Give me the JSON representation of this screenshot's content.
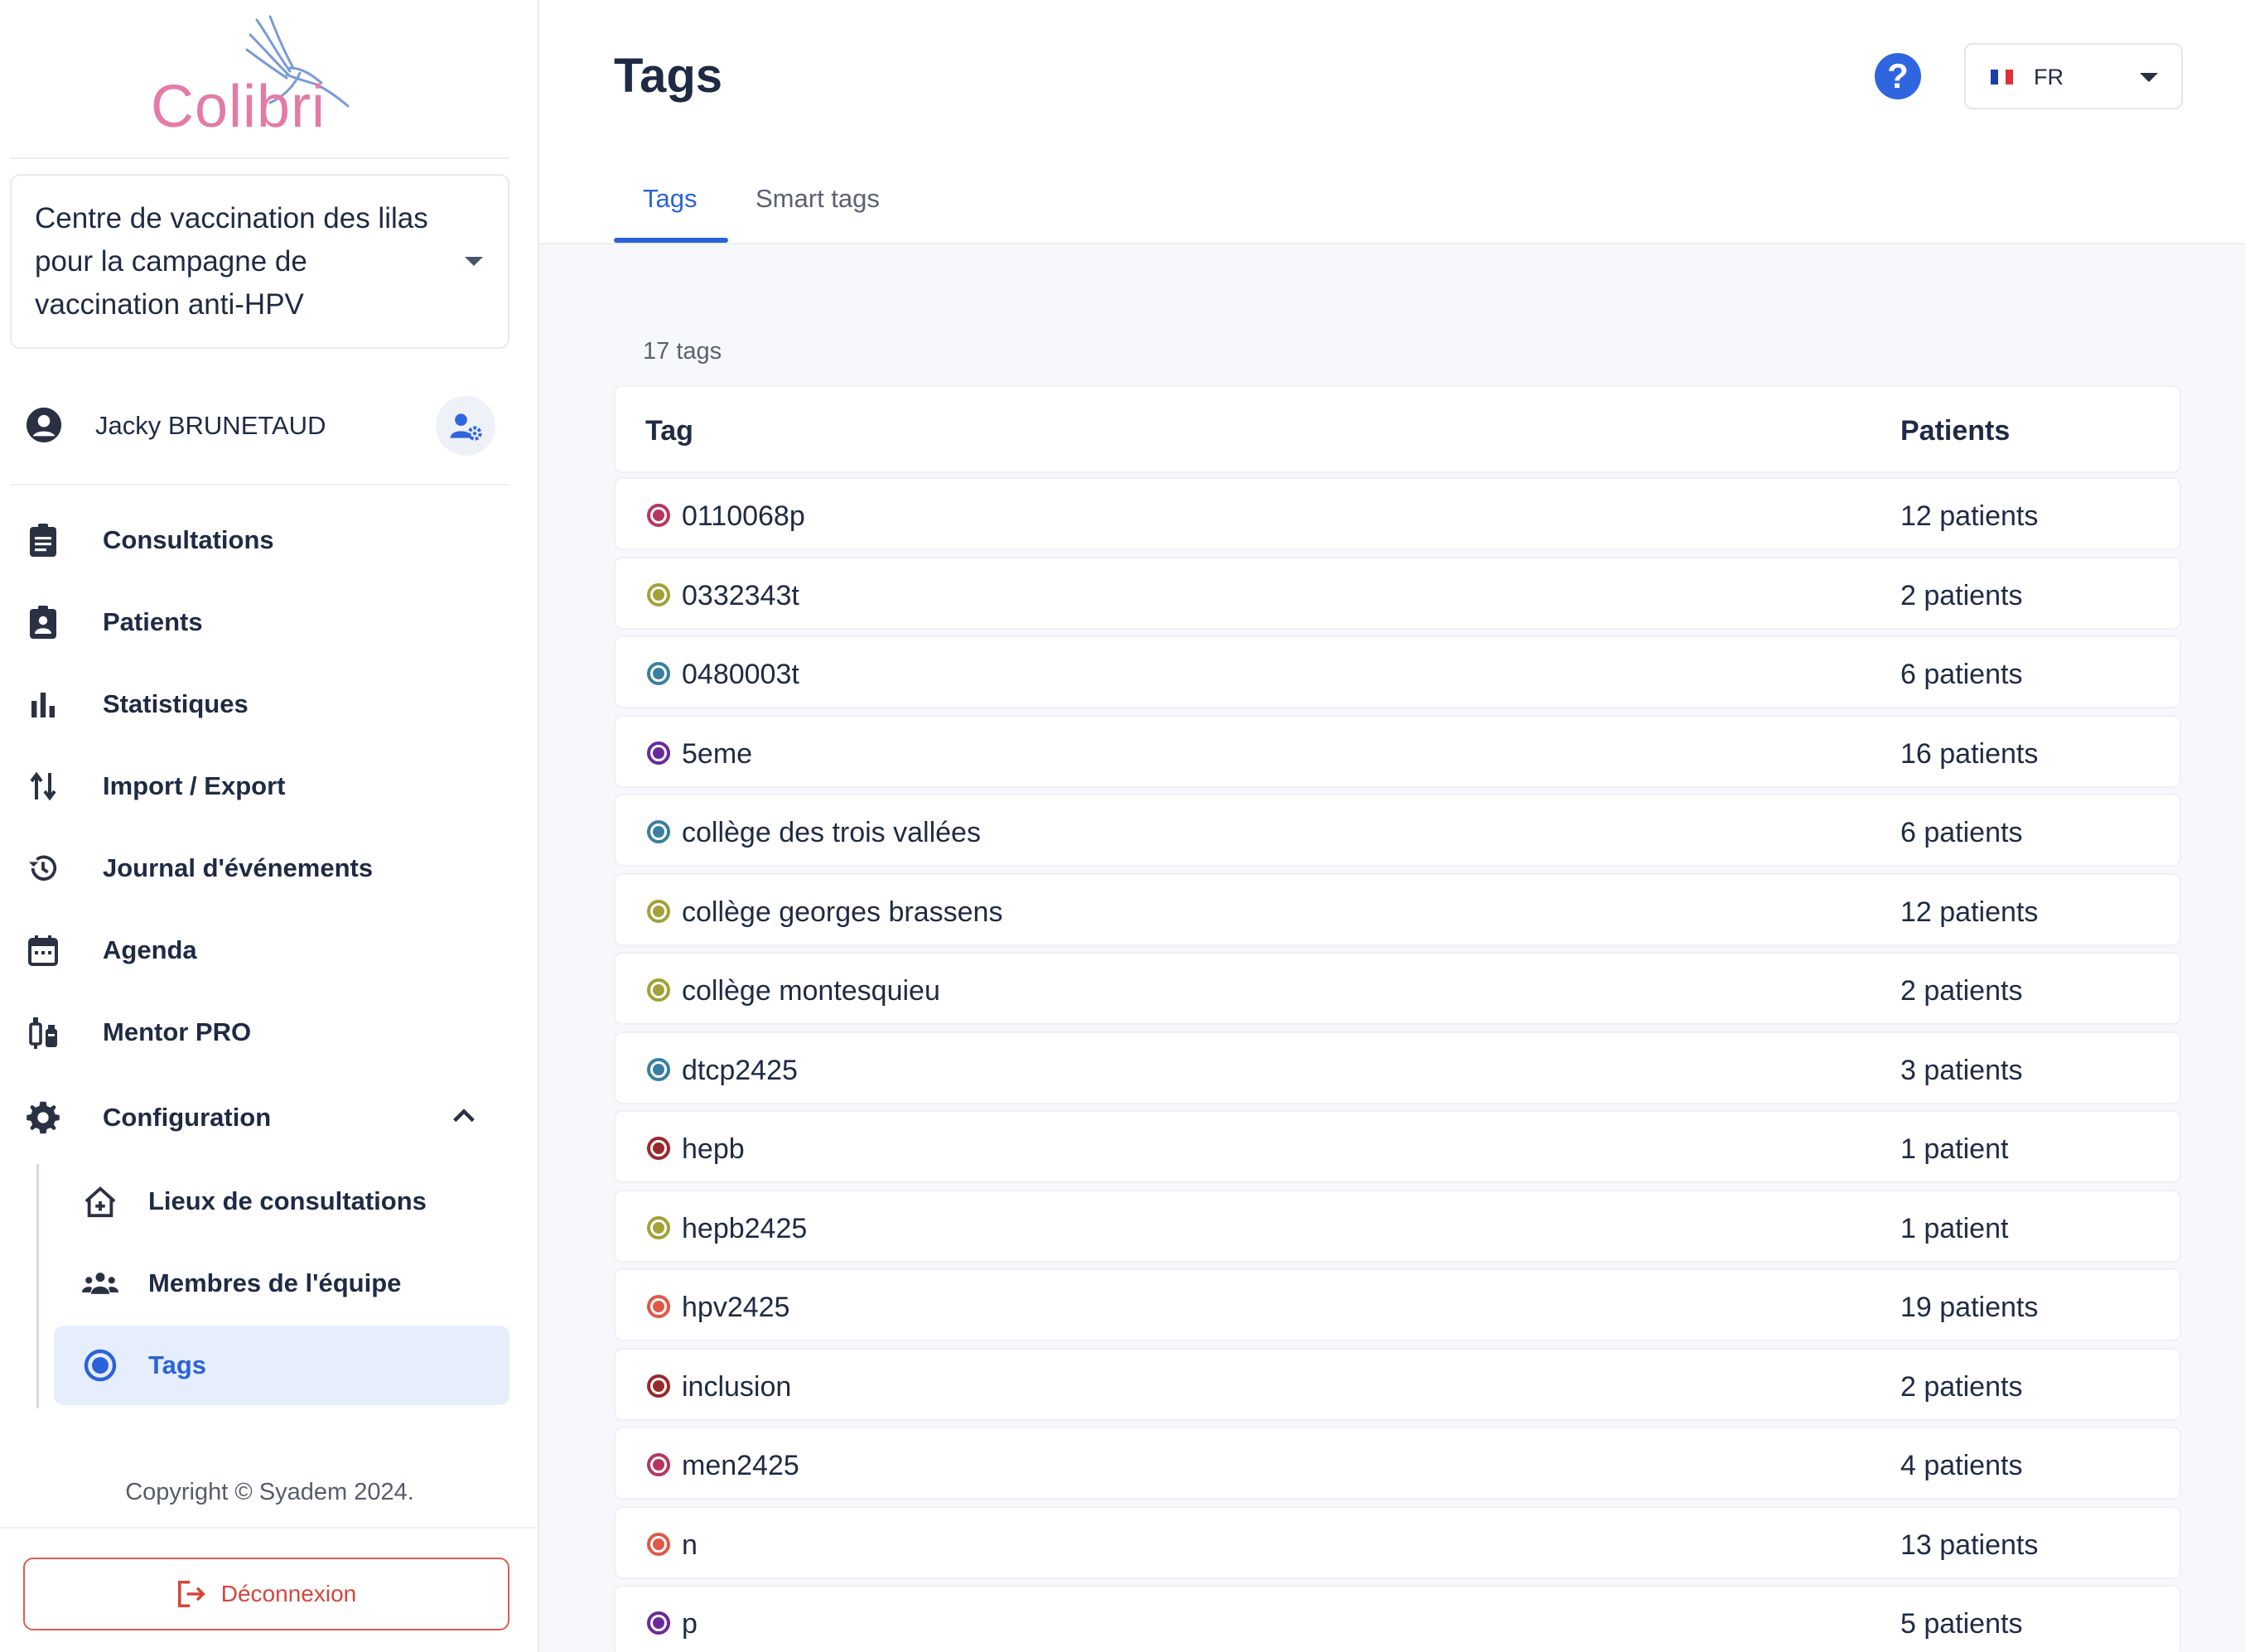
{
  "app": {
    "logo_text": "Colibri"
  },
  "sidebar": {
    "site_select": "Centre de vaccination des lilas pour la campagne de vaccination anti-HPV",
    "user_name": "Jacky BRUNETAUD",
    "nav": [
      {
        "label": "Consultations",
        "icon": "clipboard-icon"
      },
      {
        "label": "Patients",
        "icon": "patient-badge-icon"
      },
      {
        "label": "Statistiques",
        "icon": "bar-chart-icon"
      },
      {
        "label": "Import / Export",
        "icon": "import-export-icon"
      },
      {
        "label": "Journal d'événements",
        "icon": "history-icon"
      },
      {
        "label": "Agenda",
        "icon": "calendar-icon"
      },
      {
        "label": "Mentor PRO",
        "icon": "vaccine-icon"
      },
      {
        "label": "Configuration",
        "icon": "gear-icon"
      }
    ],
    "sub_nav": [
      {
        "label": "Lieux de consultations",
        "icon": "house-plus-icon"
      },
      {
        "label": "Membres de l'équipe",
        "icon": "team-icon"
      },
      {
        "label": "Tags",
        "icon": "tag-dot-icon",
        "active": true
      }
    ],
    "copyright": "Copyright © Syadem 2024.",
    "logout_label": "Déconnexion"
  },
  "header": {
    "title": "Tags",
    "help": "?",
    "lang_code": "FR",
    "tabs": [
      {
        "label": "Tags",
        "active": true
      },
      {
        "label": "Smart tags",
        "active": false
      }
    ]
  },
  "table": {
    "count_label": "17 tags",
    "col_tag": "Tag",
    "col_patients": "Patients",
    "rows": [
      {
        "name": "0110068p",
        "patients": "12 patients",
        "color": "#b5375f"
      },
      {
        "name": "0332343t",
        "patients": "2 patients",
        "color": "#a3a13a"
      },
      {
        "name": "0480003t",
        "patients": "6 patients",
        "color": "#3a7fa0"
      },
      {
        "name": "5eme",
        "patients": "16 patients",
        "color": "#6a2a9a"
      },
      {
        "name": "collège des trois vallées",
        "patients": "6 patients",
        "color": "#3a7fa0"
      },
      {
        "name": "collège georges brassens",
        "patients": "12 patients",
        "color": "#a3a13a"
      },
      {
        "name": "collège montesquieu",
        "patients": "2 patients",
        "color": "#a3a13a"
      },
      {
        "name": "dtcp2425",
        "patients": "3 patients",
        "color": "#3a7fa0"
      },
      {
        "name": "hepb",
        "patients": "1 patient",
        "color": "#9a2a2a"
      },
      {
        "name": "hepb2425",
        "patients": "1 patient",
        "color": "#a3a13a"
      },
      {
        "name": "hpv2425",
        "patients": "19 patients",
        "color": "#e0584a"
      },
      {
        "name": "inclusion",
        "patients": "2 patients",
        "color": "#9a2a2a"
      },
      {
        "name": "men2425",
        "patients": "4 patients",
        "color": "#b5375f"
      },
      {
        "name": "n",
        "patients": "13 patients",
        "color": "#e0584a"
      },
      {
        "name": "p",
        "patients": "5 patients",
        "color": "#6a2a9a"
      }
    ]
  }
}
